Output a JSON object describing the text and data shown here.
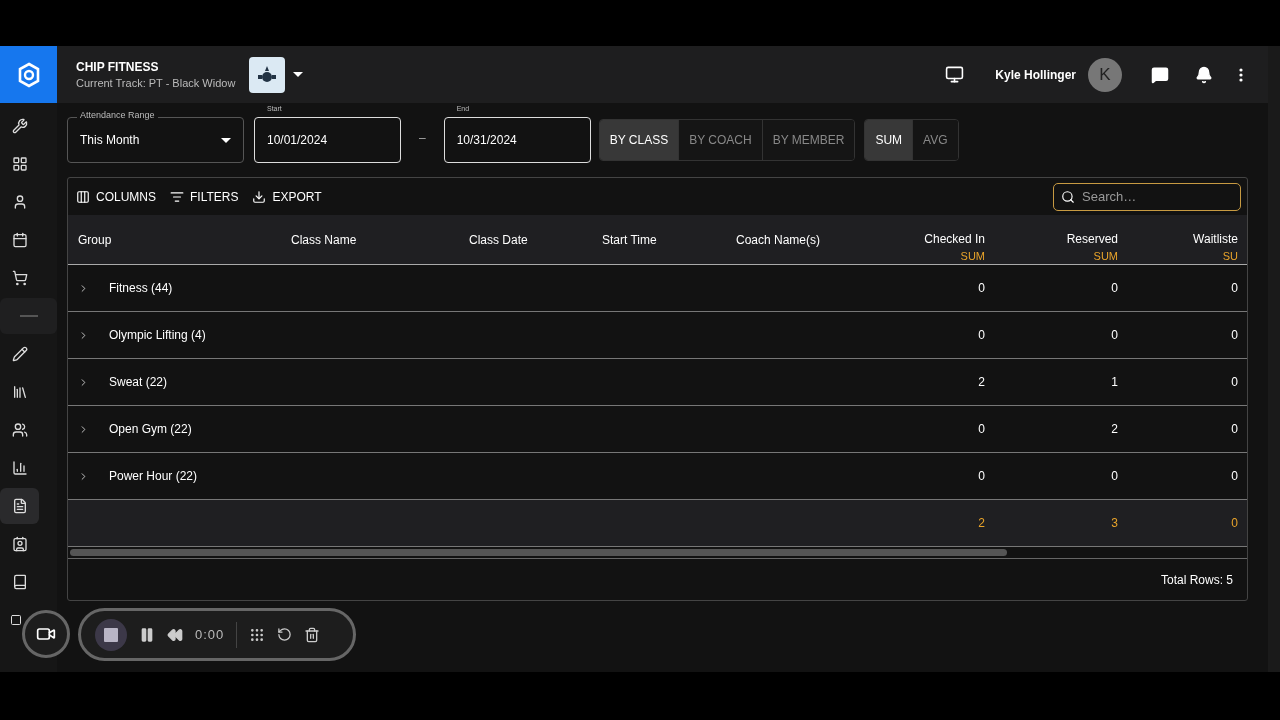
{
  "header": {
    "title": "CHIP FITNESS",
    "subtitle": "Current Track: PT - Black Widow",
    "user_name": "Kyle Hollinger",
    "avatar_initial": "K"
  },
  "sidebar": {
    "items": [
      {
        "kind": "icon",
        "selected": false
      },
      {
        "kind": "icon",
        "selected": false
      },
      {
        "kind": "icon",
        "selected": false
      },
      {
        "kind": "icon",
        "selected": false
      },
      {
        "kind": "icon",
        "selected": false
      },
      {
        "kind": "separator",
        "selected": false
      },
      {
        "kind": "icon",
        "selected": false
      },
      {
        "kind": "icon",
        "selected": false
      },
      {
        "kind": "icon",
        "selected": false
      },
      {
        "kind": "icon",
        "selected": false
      },
      {
        "kind": "icon",
        "selected": true
      },
      {
        "kind": "icon",
        "selected": false
      },
      {
        "kind": "icon",
        "selected": false
      },
      {
        "kind": "icon",
        "selected": false
      }
    ]
  },
  "filters": {
    "range": {
      "label": "Attendance Range",
      "value": "This Month"
    },
    "start": {
      "label": "Start",
      "value": "10/01/2024"
    },
    "separator": "–",
    "end": {
      "label": "End",
      "value": "10/31/2024"
    },
    "view_modes": [
      {
        "label": "BY CLASS",
        "selected": true
      },
      {
        "label": "BY COACH",
        "selected": false
      },
      {
        "label": "BY MEMBER",
        "selected": false
      }
    ],
    "aggregates": [
      {
        "label": "SUM",
        "selected": true
      },
      {
        "label": "AVG",
        "selected": false
      }
    ]
  },
  "table": {
    "toolbar": [
      "COLUMNS",
      "FILTERS",
      "EXPORT"
    ],
    "search": {
      "placeholder": "Search…"
    },
    "columns": [
      {
        "label": "Group"
      },
      {
        "label": "Class Name"
      },
      {
        "label": "Class Date"
      },
      {
        "label": "Start Time"
      },
      {
        "label": "Coach Name(s)"
      },
      {
        "label": "Checked In",
        "aggregate": "SUM"
      },
      {
        "label": "Reserved",
        "aggregate": "SUM"
      },
      {
        "label": "Waitliste",
        "aggregate": "SU"
      }
    ],
    "rows": [
      {
        "group": "Fitness (44)",
        "expanded": false,
        "values": [
          "0",
          "0",
          "0"
        ]
      },
      {
        "group": "Olympic Lifting (4)",
        "expanded": false,
        "values": [
          "0",
          "0",
          "0"
        ]
      },
      {
        "group": "Sweat (22)",
        "expanded": false,
        "values": [
          "2",
          "1",
          "0"
        ]
      },
      {
        "group": "Open Gym (22)",
        "expanded": false,
        "values": [
          "0",
          "2",
          "0"
        ]
      },
      {
        "group": "Power Hour (22)",
        "expanded": false,
        "values": [
          "0",
          "0",
          "0"
        ]
      }
    ],
    "totals": [
      "2",
      "3",
      "0"
    ],
    "footer": "Total Rows: 5"
  },
  "recorder": {
    "time": "0:00"
  }
}
